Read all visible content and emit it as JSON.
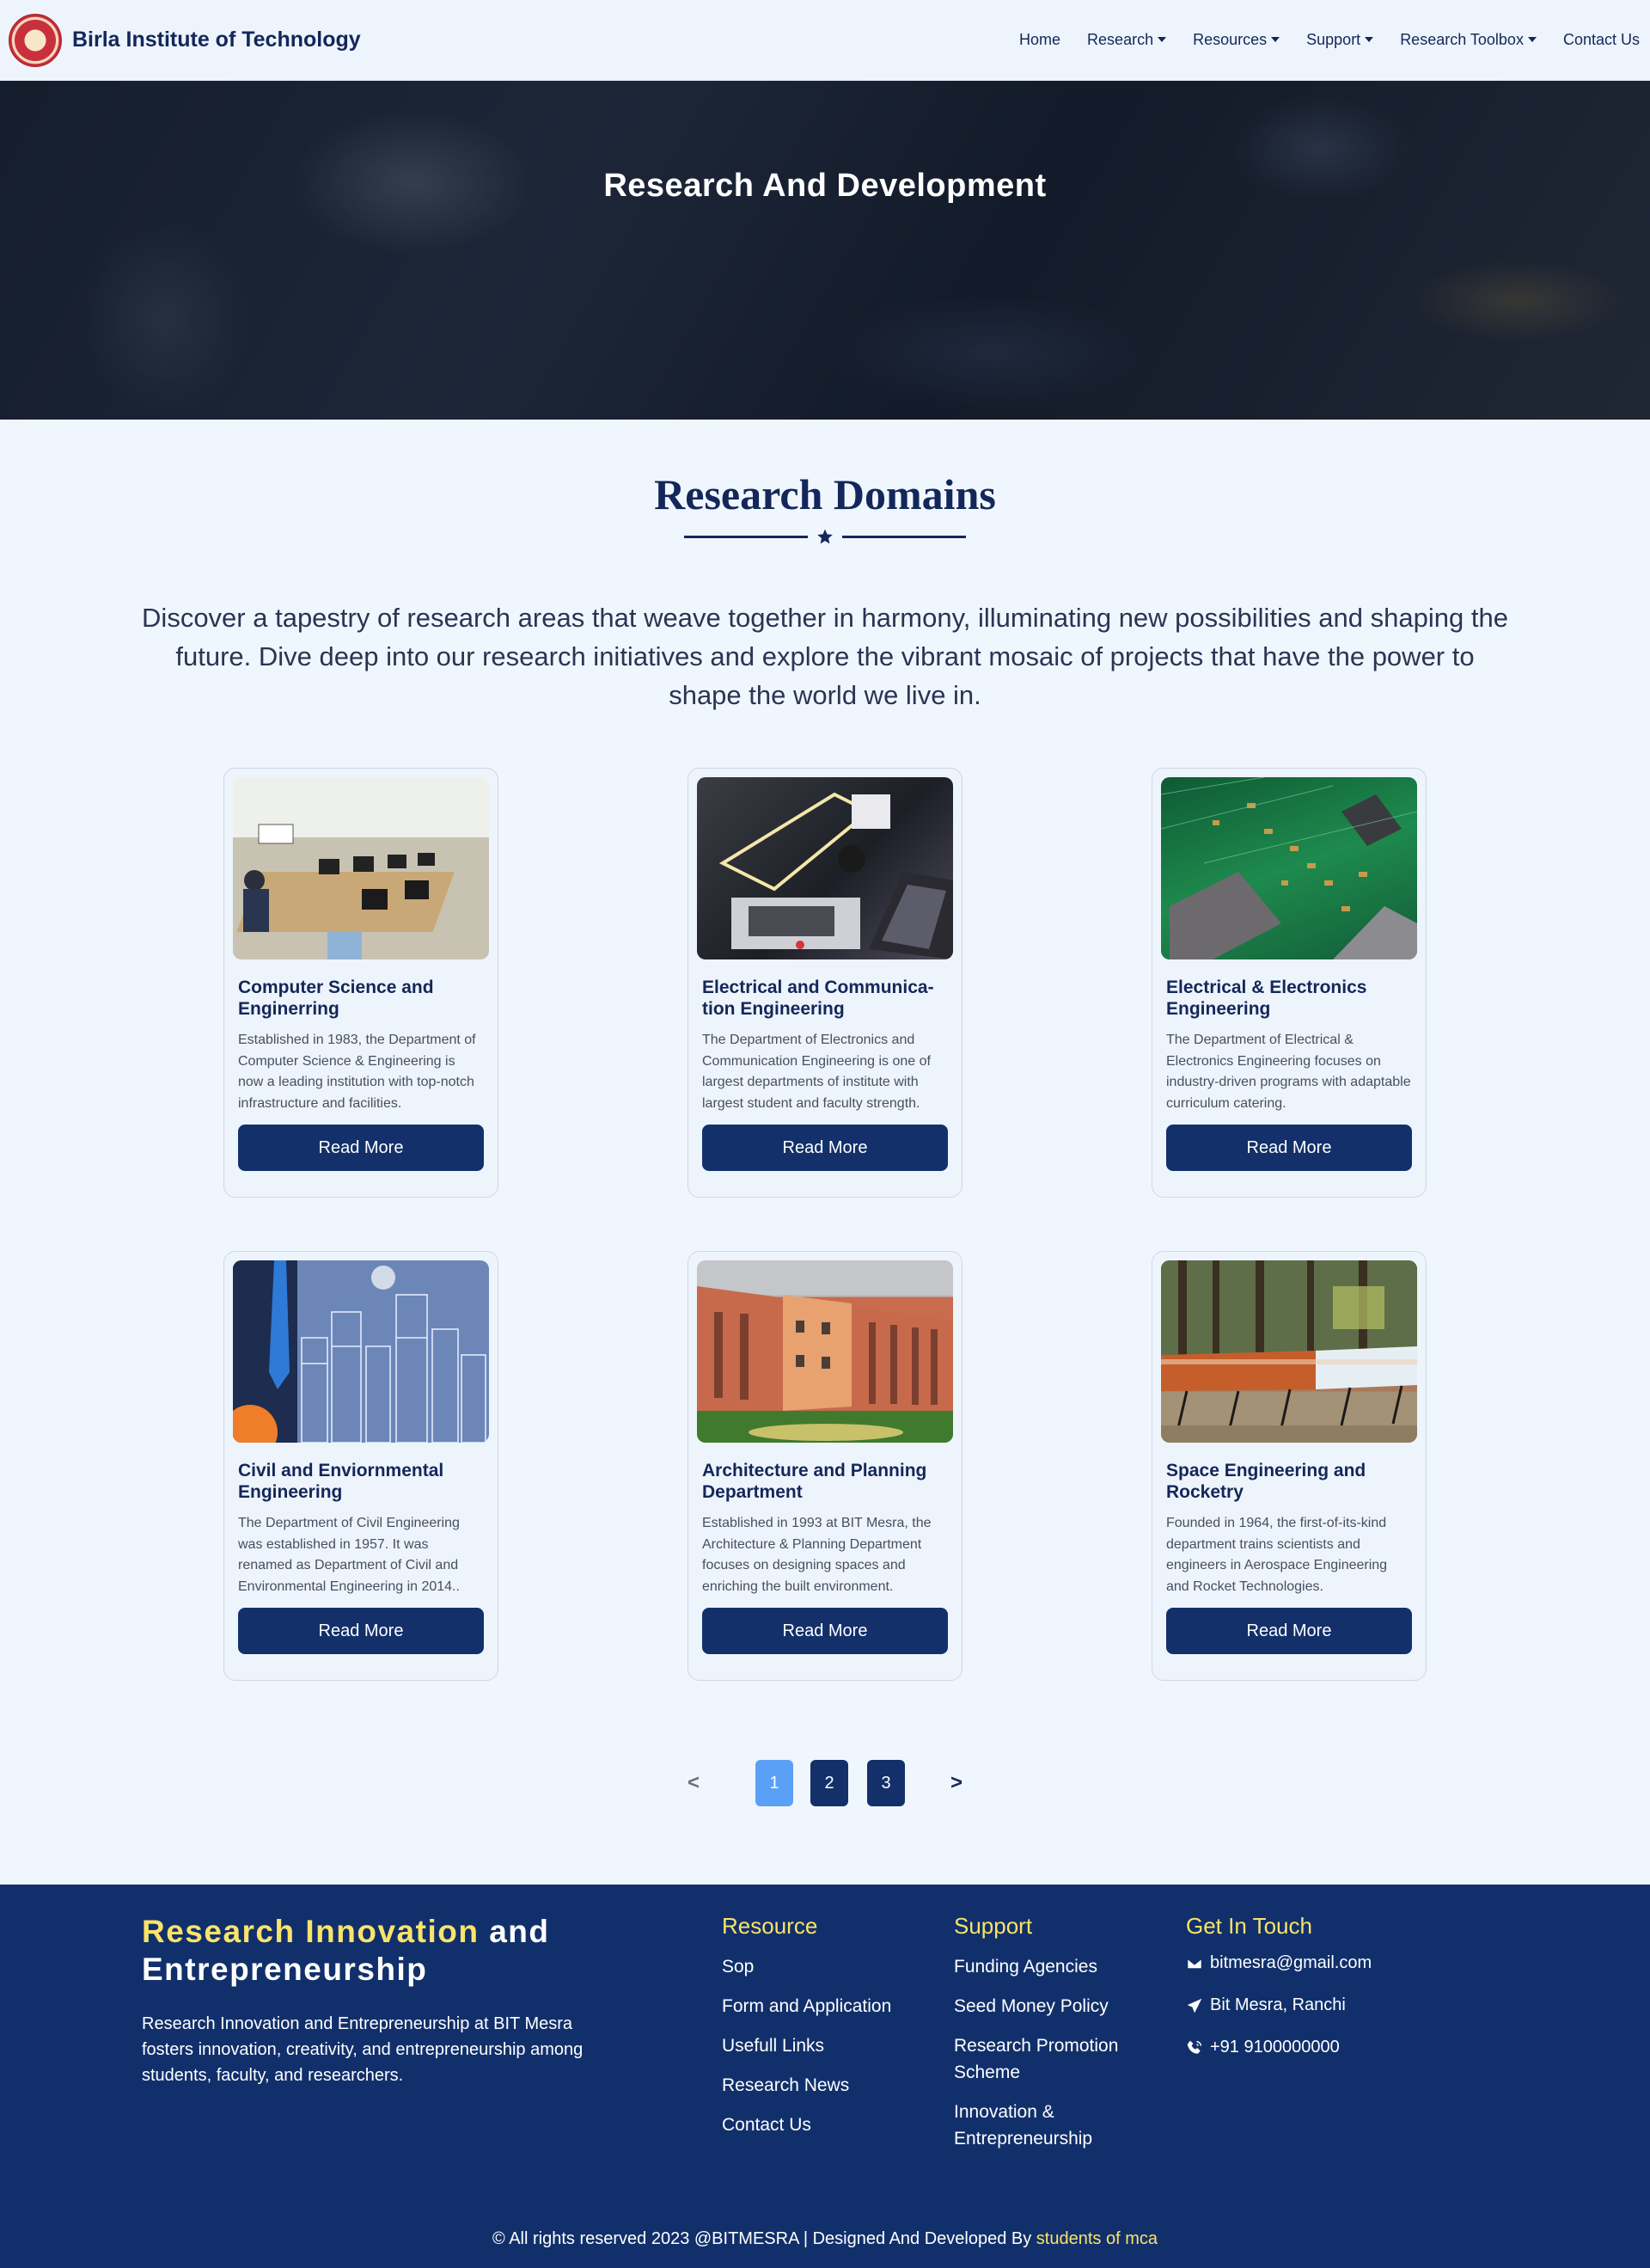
{
  "nav": {
    "brand": "Birla Institute of Technology",
    "links": [
      {
        "label": "Home",
        "dropdown": false
      },
      {
        "label": "Research",
        "dropdown": true
      },
      {
        "label": "Resources",
        "dropdown": true
      },
      {
        "label": "Support",
        "dropdown": true
      },
      {
        "label": "Research Toolbox",
        "dropdown": true
      },
      {
        "label": "Contact Us",
        "dropdown": false
      }
    ]
  },
  "hero": {
    "title": "Research And Development"
  },
  "domains": {
    "title": "Research Domains",
    "intro": "Discover a tapestry of research areas that weave together in harmony, illuminating new possibilities and shaping the future. Dive deep into our research initiatives and explore the vibrant mosaic of projects that have the power to shape the world we live in.",
    "cards": [
      {
        "title": "Computer Science and Enginerring",
        "desc": "Established in 1983, the Department of Computer Science & Engineering is now a leading institution with top-notch infrastructure and facilities.",
        "button": "Read More",
        "image": "computer-lab-photo"
      },
      {
        "title": "Electrical and Communica-tion Engineering",
        "desc": "The Department of Electronics and Communication Engineering is one of largest departments of institute with largest student and faculty strength.",
        "button": "Read More",
        "image": "robotics-lab-photo"
      },
      {
        "title": "Electrical & Electronics Engineering",
        "desc": "The Department of Electrical & Electronics Engineering focuses on industry-driven programs with adaptable curriculum catering.",
        "button": "Read More",
        "image": "circuit-board-photo"
      },
      {
        "title": "Civil and Enviornmental Engineering",
        "desc": "The Department of Civil Engineering was established in 1957. It was renamed as Department of Civil and Environmental Engineering in 2014..",
        "button": "Read More",
        "image": "city-skyline-photo"
      },
      {
        "title": "Architecture and Planning Department",
        "desc": "Established in 1993 at BIT Mesra, the Architecture & Planning Department focuses on designing spaces and enriching the built environment.",
        "button": "Read More",
        "image": "campus-building-photo"
      },
      {
        "title": "Space Engineering and Rocketry",
        "desc": "Founded in 1964, the first-of-its-kind department trains scientists and engineers in Aerospace Engineering and Rocket Technologies.",
        "button": "Read More",
        "image": "rocket-display-photo"
      }
    ]
  },
  "pagination": {
    "prev": "<",
    "next": ">",
    "pages": [
      "1",
      "2",
      "3"
    ],
    "current": "1"
  },
  "footer": {
    "brand_highlight": "Research Innovation",
    "brand_rest": "and Entrepreneurship",
    "description": "Research Innovation and Entrepreneurship at BIT Mesra fosters innovation, creativity, and entrepreneurship among students, faculty, and researchers.",
    "resource": {
      "title": "Resource",
      "links": [
        "Sop",
        "Form and Application",
        "Usefull Links",
        "Research News",
        "Contact Us"
      ]
    },
    "support": {
      "title": "Support",
      "links": [
        "Funding Agencies",
        "Seed Money Policy",
        "Research Promotion Scheme",
        "Innovation & Entrepreneurship"
      ]
    },
    "contact": {
      "title": "Get In Touch",
      "items": [
        {
          "icon": "envelope-icon",
          "text": "bitmesra@gmail.com"
        },
        {
          "icon": "paper-plane-icon",
          "text": "Bit Mesra, Ranchi"
        },
        {
          "icon": "phone-volume-icon",
          "text": "+91 9100000000"
        }
      ]
    },
    "copyright": "© All rights reserved 2023 @BITMESRA | Designed And Developed By",
    "credit": "students of mca"
  },
  "colors": {
    "navy": "#13306a",
    "accent_yellow": "#fae36a",
    "page_active": "#5aa0f7",
    "background": "#f0f6fd"
  }
}
